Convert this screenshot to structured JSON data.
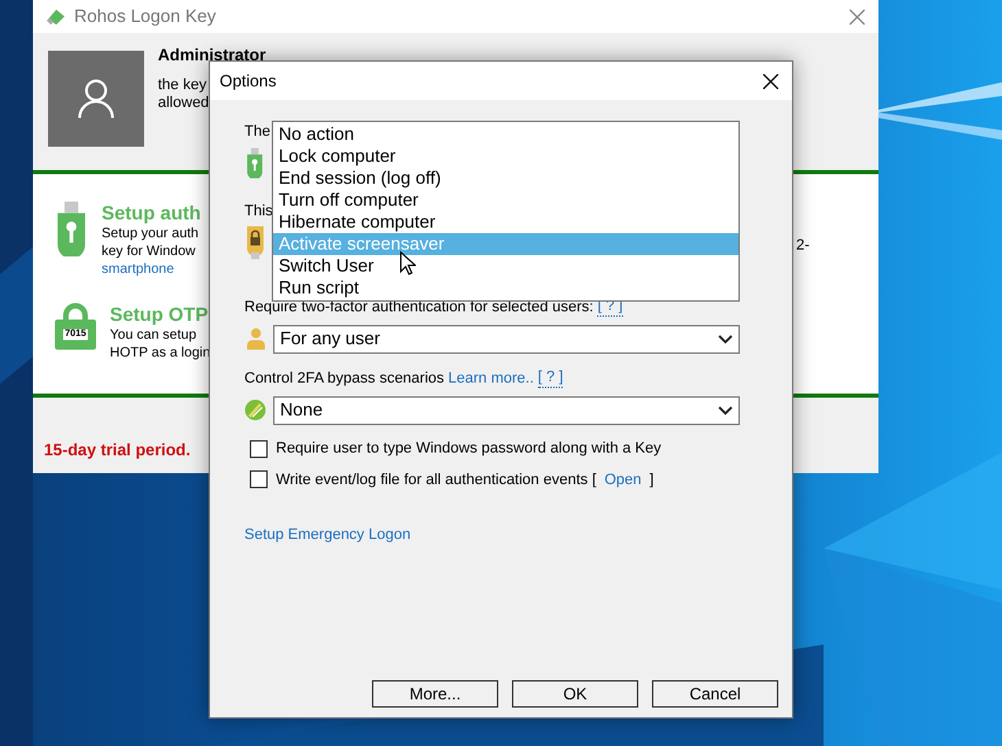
{
  "background_window": {
    "title": "Rohos Logon Key",
    "user_name": "Administrator",
    "user_lines": [
      "the key",
      "allowed"
    ],
    "sections": [
      {
        "kind": "key",
        "title": "Setup auth",
        "lines": [
          "Setup your auth",
          "key for Window"
        ],
        "link": "smartphone"
      },
      {
        "kind": "otp",
        "title": "Setup OTP",
        "otp_code": "7015",
        "lines": [
          "You can setup",
          "HOTP as a login"
        ]
      }
    ],
    "side_text": "2-",
    "trial_notice": "15-day trial period."
  },
  "dialog": {
    "title": "Options",
    "settings": [
      {
        "kind": "key",
        "label": "The"
      },
      {
        "kind": "lock",
        "label": "This"
      },
      {
        "kind": "user",
        "label": "Require two-factor authentication for selected users:",
        "help": "[ ? ]",
        "value": "For any user"
      },
      {
        "kind": "bypass",
        "label": "Control 2FA bypass scenarios",
        "link": "Learn more..",
        "help": "[ ? ]",
        "value": "None"
      }
    ],
    "checkboxes": [
      {
        "label": "Require user to type Windows password along with a Key",
        "checked": false
      },
      {
        "label": "Write event/log file for all authentication events [",
        "link": "Open",
        "suffix": "]",
        "checked": false
      }
    ],
    "emergency_link": "Setup Emergency Logon",
    "buttons": [
      "More...",
      "OK",
      "Cancel"
    ],
    "dropdown_list": {
      "items": [
        {
          "label": "No action",
          "selected": false
        },
        {
          "label": "Lock computer",
          "selected": false
        },
        {
          "label": "End session (log off)",
          "selected": false
        },
        {
          "label": "Turn off computer",
          "selected": false
        },
        {
          "label": "Hibernate computer",
          "selected": false
        },
        {
          "label": "Activate screensaver",
          "selected": true
        },
        {
          "label": "Switch User",
          "selected": false
        },
        {
          "label": "Run script",
          "selected": false
        }
      ]
    }
  }
}
